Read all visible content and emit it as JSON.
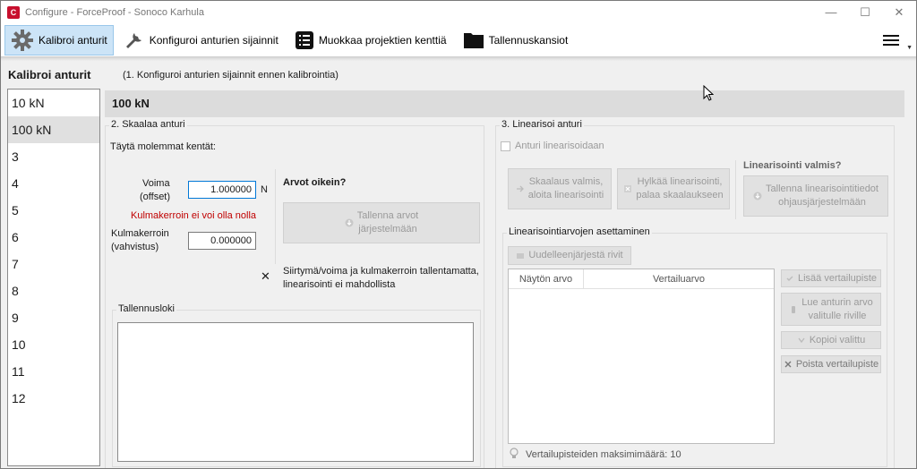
{
  "window": {
    "title": "Configure - ForceProof - Sonoco Karhula",
    "app_icon_letter": "C",
    "minimize": "—",
    "maximize": "☐",
    "close": "✕"
  },
  "toolbar": {
    "items": [
      {
        "label": "Kalibroi anturit",
        "icon": "gear-icon",
        "active": true
      },
      {
        "label": "Konfiguroi anturien sijainnit",
        "icon": "wrench-icon",
        "active": false
      },
      {
        "label": "Muokkaa projektien kenttiä",
        "icon": "list-icon",
        "active": false
      },
      {
        "label": "Tallennuskansiot",
        "icon": "folder-icon",
        "active": false
      }
    ],
    "menu_icon": "hamburger-menu-icon",
    "menu_arrow": "▼"
  },
  "left": {
    "title": "Kalibroi anturit",
    "hint": "(1. Konfiguroi anturien sijainnit ennen kalibrointia)",
    "sensors": [
      "10 kN",
      "100 kN",
      "3",
      "4",
      "5",
      "6",
      "7",
      "8",
      "9",
      "10",
      "11",
      "12"
    ],
    "selected_index": 1
  },
  "header": {
    "selected_title": "100 kN"
  },
  "scale": {
    "group_label": "2. Skaalaa anturi",
    "instruction": "Täytä molemmat kentät:",
    "force_label_line1": "Voima",
    "force_label_line2": "(offset)",
    "force_value": "1.000000",
    "force_unit": "N",
    "error": "Kulmakerroin ei voi olla nolla",
    "slope_label_line1": "Kulmakerroin",
    "slope_label_line2": "(vahvistus)",
    "slope_value": "0.000000",
    "values_ok_title": "Arvot oikein?",
    "save_button_line1": "Tallenna arvot",
    "save_button_line2": "järjestelmään",
    "status_icon": "✕",
    "status_line1": "Siirtymä/voima ja kulmakerroin tallentamatta,",
    "status_line2": "linearisointi ei mahdollista",
    "log_label": "Tallennusloki"
  },
  "linearize": {
    "group_label": "3. Linearisoi anturi",
    "checkbox_label": "Anturi linearisoidaan",
    "scale_done_line1": "Skaalaus valmis,",
    "scale_done_line2": "aloita linearisointi",
    "reject_line1": "Hylkää linearisointi,",
    "reject_line2": "palaa skaalaukseen",
    "ready_title": "Linearisointi valmis?",
    "save_line1": "Tallenna linearisointitiedot",
    "save_line2": "ohjausjärjestelmään",
    "setup_label": "Linearisointiarvojen asettaminen",
    "reorder_button": "Uudelleenjärjestä rivit",
    "col_display": "Näytön arvo",
    "col_reference": "Vertailuarvo",
    "add_point": "Lisää vertailupiste",
    "read_line1": "Lue anturin arvo",
    "read_line2": "valitulle riville",
    "copy_selected": "Kopioi valittu",
    "remove_point": "Poista vertailupiste",
    "max_points": "Vertailupisteiden maksimimäärä: 10"
  }
}
